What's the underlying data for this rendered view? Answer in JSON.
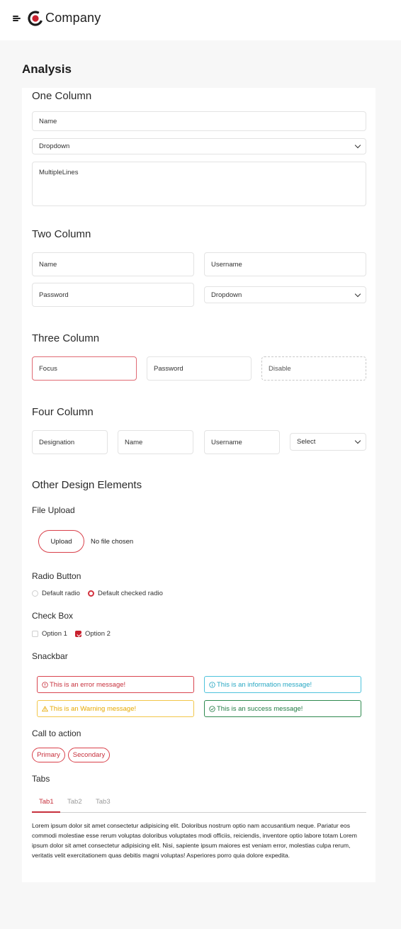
{
  "header": {
    "brand": "Company",
    "colors": {
      "accent": "#c8202e"
    }
  },
  "page": {
    "title": "Analysis"
  },
  "one_column": {
    "title": "One Column",
    "name_placeholder": "Name",
    "dropdown_value": "Dropdown",
    "multiline_placeholder": "MultipleLines"
  },
  "two_column": {
    "title": "Two Column",
    "name_placeholder": "Name",
    "username_placeholder": "Username",
    "password_placeholder": "Password",
    "dropdown_value": "Dropdown"
  },
  "three_column": {
    "title": "Three Column",
    "focus_placeholder": "Focus",
    "password_placeholder": "Password",
    "disable_placeholder": "Disable"
  },
  "four_column": {
    "title": "Four Column",
    "designation_placeholder": "Designation",
    "name_placeholder": "Name",
    "username_placeholder": "Username",
    "select_value": "Select"
  },
  "other": {
    "title": "Other Design Elements",
    "file_upload": {
      "title": "File Upload",
      "button": "Upload",
      "status": "No file chosen"
    },
    "radio": {
      "title": "Radio Button",
      "option1": "Default radio",
      "option2": "Default checked radio",
      "checked": 2
    },
    "checkbox": {
      "title": "Check Box",
      "option1": "Option 1",
      "option2": "Option 2",
      "checked": [
        2
      ]
    },
    "snackbar": {
      "title": "Snackbar",
      "error": "This is an error message!",
      "info": "This is an information message!",
      "warning": "This is an Warning message!",
      "success": "This is an success message!"
    },
    "cta": {
      "title": "Call to action",
      "primary": "Primary",
      "secondary": "Secondary"
    },
    "tabs": {
      "title": "Tabs",
      "items": [
        "Tab1",
        "Tab2",
        "Tab3"
      ],
      "active": "Tab1",
      "content": "Lorem ipsum dolor sit amet consectetur adipisicing elit. Doloribus nostrum optio nam accusantium neque. Pariatur eos commodi molestiae esse rerum voluptas doloribus voluptates modi officiis, reiciendis, inventore optio labore totam Lorem ipsum dolor sit amet consectetur adipisicing elit. Nisi, sapiente ipsum maiores est veniam error, molestias culpa rerum, veritatis velit exercitationem quas debitis magni voluptas! Asperiores porro quia dolore expedita."
    }
  }
}
